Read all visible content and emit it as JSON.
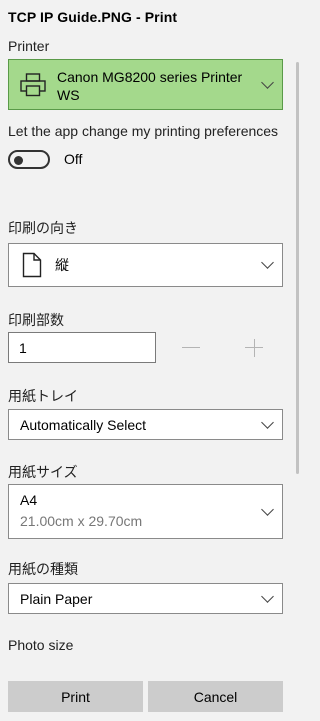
{
  "window": {
    "title": "TCP IP Guide.PNG - Print"
  },
  "printer": {
    "label": "Printer",
    "value": "Canon MG8200 series Printer WS",
    "icon": "printer-icon",
    "highlight_color": "#a4d98c"
  },
  "preferences": {
    "label": "Let the app change my printing preferences",
    "toggle_state": "Off"
  },
  "orientation": {
    "label": "印刷の向き",
    "value": "縦",
    "icon": "page-icon"
  },
  "copies": {
    "label": "印刷部数",
    "value": "1"
  },
  "paper_tray": {
    "label": "用紙トレイ",
    "value": "Automatically Select"
  },
  "paper_size": {
    "label": "用紙サイズ",
    "value": "A4",
    "dimensions": "21.00cm x 29.70cm"
  },
  "paper_type": {
    "label": "用紙の種類",
    "value": "Plain Paper"
  },
  "photo_size": {
    "label": "Photo size"
  },
  "buttons": {
    "print": "Print",
    "cancel": "Cancel"
  }
}
